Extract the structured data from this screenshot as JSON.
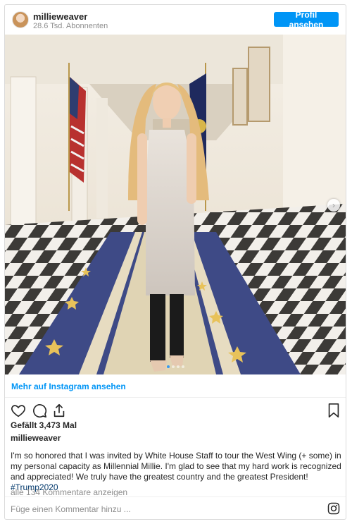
{
  "header": {
    "username": "millieweaver",
    "followers": "28.6 Tsd. Abonnenten",
    "profile_button": "Profil ansehen"
  },
  "photo": {
    "description_icon": "photo-carousel",
    "carousel_dots": 4,
    "active_dot": 0
  },
  "more_link": "Mehr auf Instagram ansehen",
  "actions": {
    "like_icon": "heart-icon",
    "comment_icon": "comment-icon",
    "share_icon": "share-icon",
    "save_icon": "bookmark-icon"
  },
  "likes": "Gefällt 3,473 Mal",
  "caption": {
    "username": "millieweaver",
    "text": "I'm so honored that I was invited by White House Staff to tour the West Wing (+ some) in my personal capacity as Millennial Millie. I'm glad to see that my hard work is recognized and appreciated! We truly have the greatest country and the greatest President!",
    "hashtag": "#Trump2020"
  },
  "view_comments": "alle 134 Kommentare anzeigen",
  "comment_placeholder": "Füge einen Kommentar hinzu ...",
  "colors": {
    "accent": "#0095f6",
    "text": "#262626",
    "muted": "#8e8e8e"
  }
}
